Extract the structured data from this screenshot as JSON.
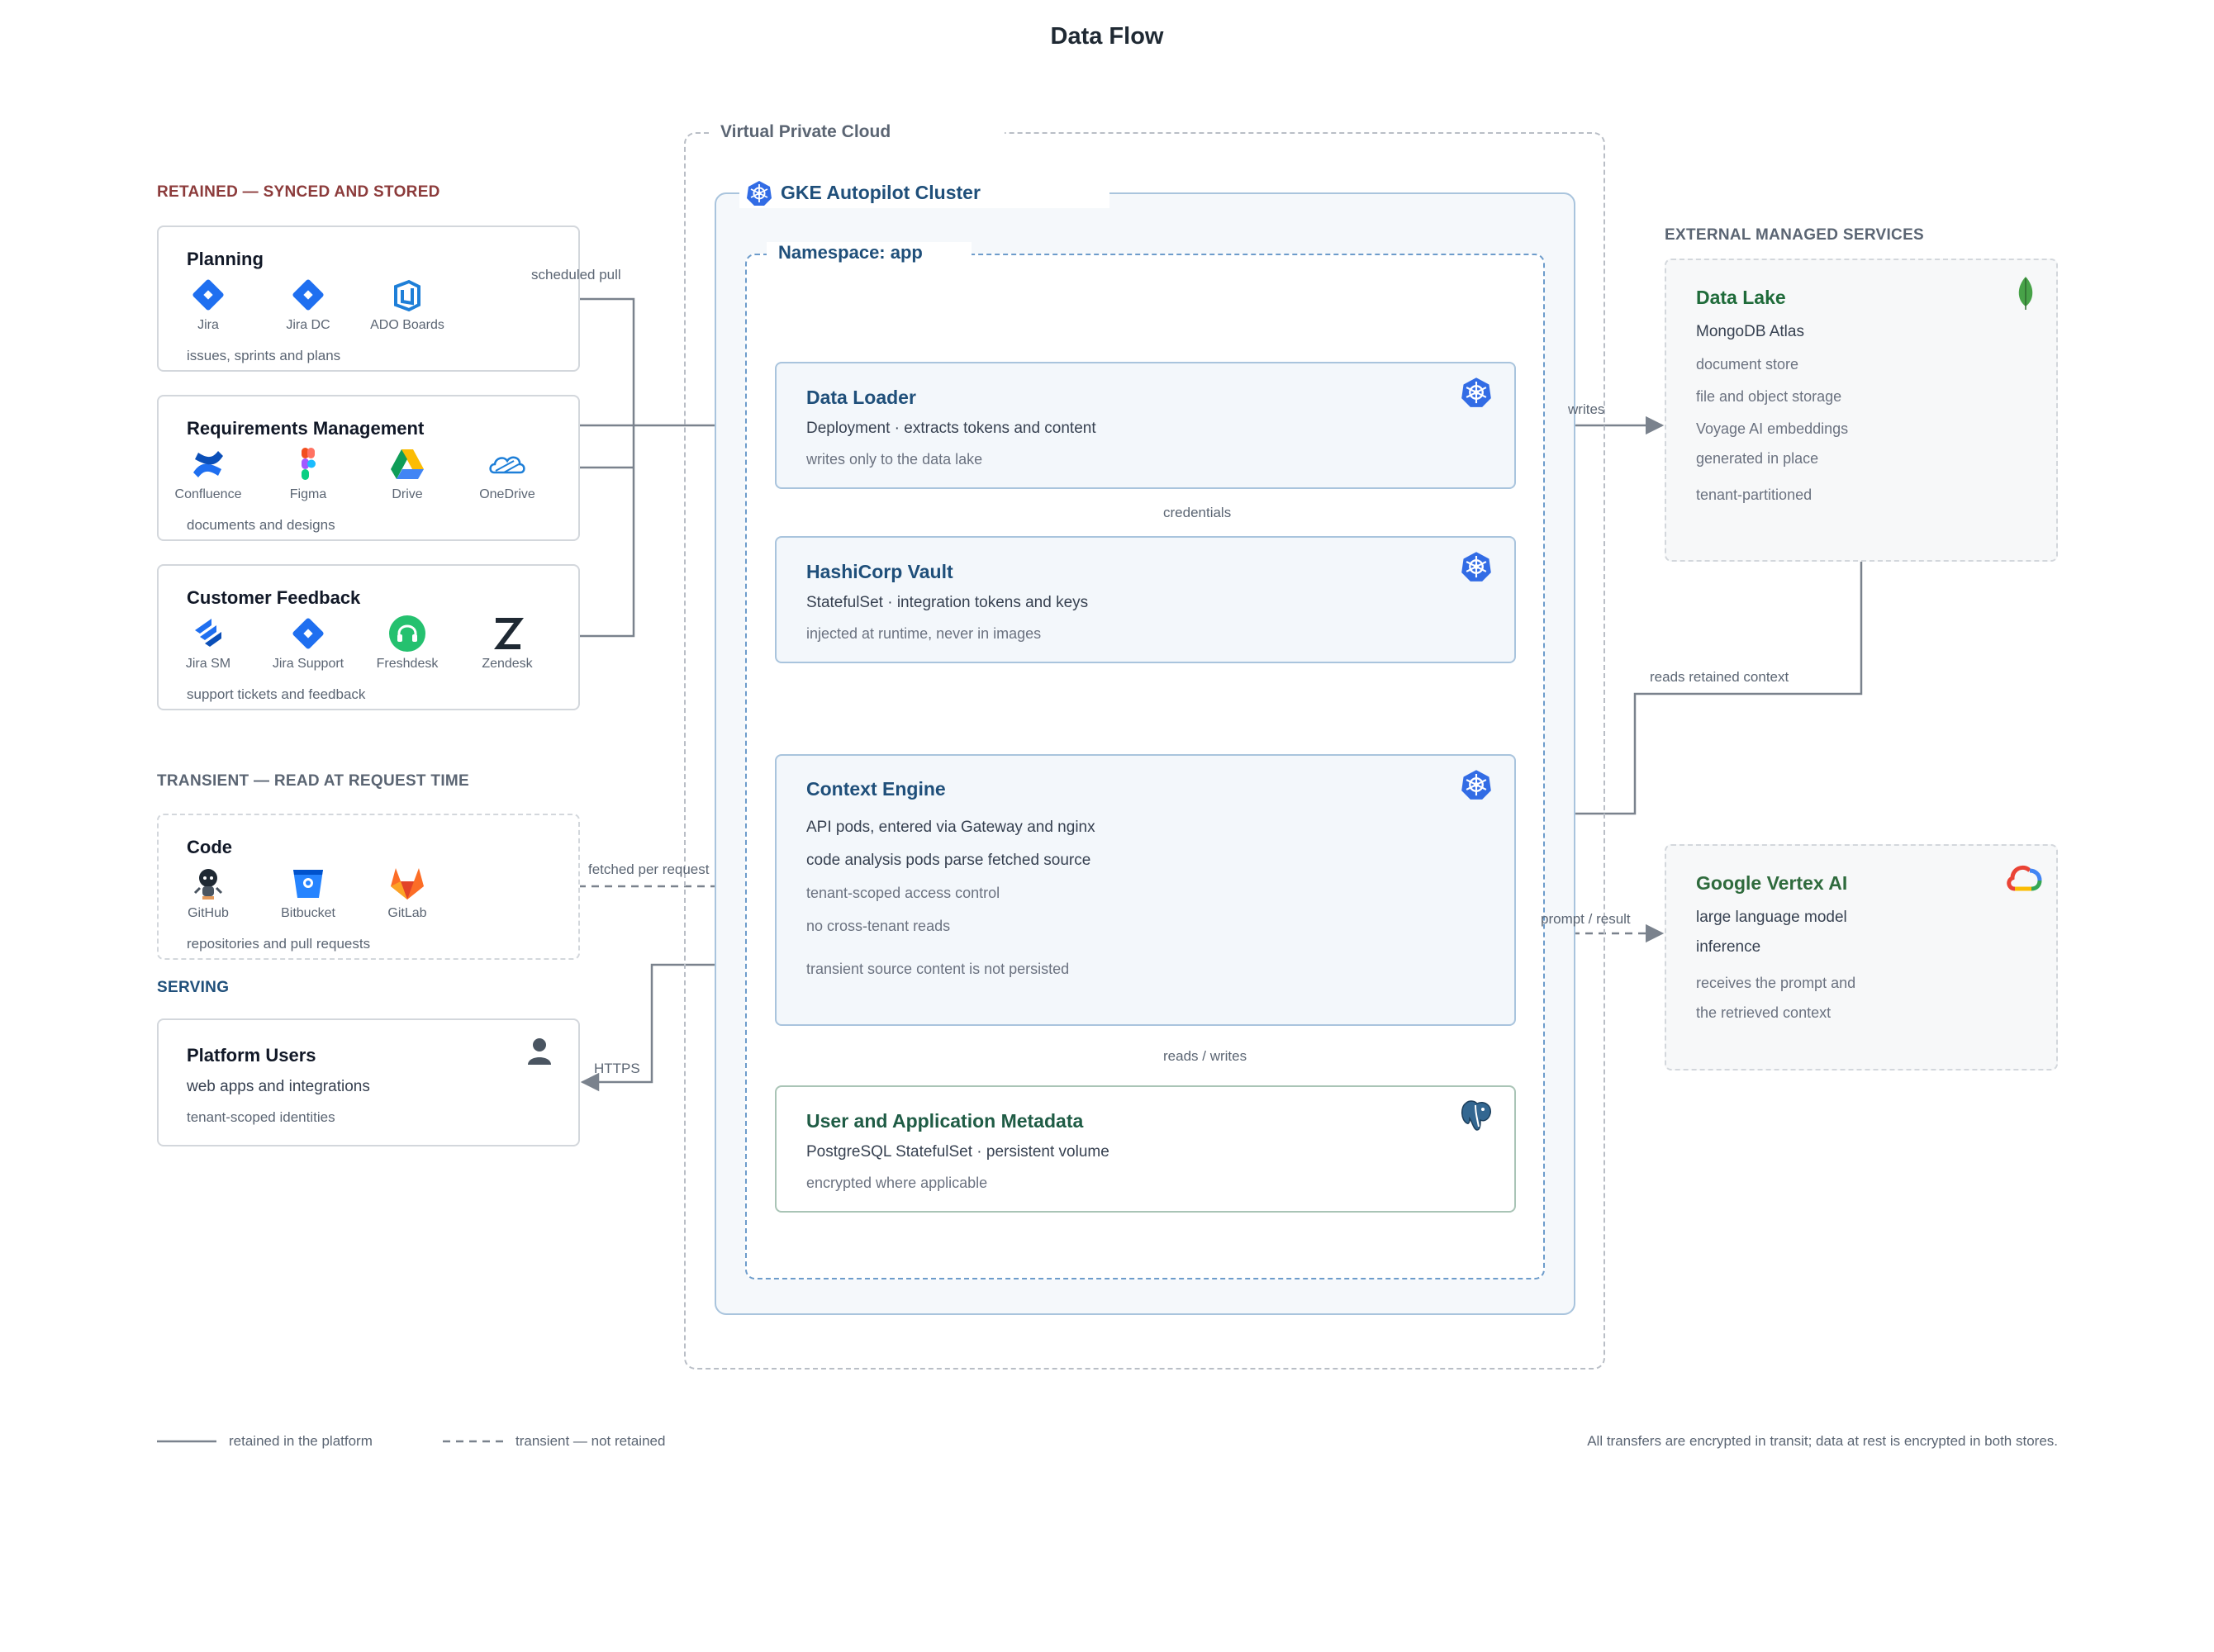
{
  "title": "Data Flow",
  "sections": {
    "retained": "RETAINED — SYNCED AND STORED",
    "transient": "TRANSIENT — READ AT REQUEST TIME",
    "serving": "SERVING",
    "external": "EXTERNAL MANAGED SERVICES"
  },
  "sources": {
    "planning": {
      "title": "Planning",
      "tools": [
        "Jira",
        "Jira DC",
        "ADO Boards"
      ],
      "caption": "issues, sprints and plans"
    },
    "requirements": {
      "title": "Requirements Management",
      "tools": [
        "Confluence",
        "Figma",
        "Drive",
        "OneDrive"
      ],
      "caption": "documents and designs"
    },
    "feedback": {
      "title": "Customer Feedback",
      "tools": [
        "Jira SM",
        "Jira Support",
        "Freshdesk",
        "Zendesk"
      ],
      "caption": "support tickets and feedback"
    },
    "code": {
      "title": "Code",
      "tools": [
        "GitHub",
        "Bitbucket",
        "GitLab"
      ],
      "caption": "repositories and pull requests"
    }
  },
  "users": {
    "title": "Platform Users",
    "line1": "web apps and integrations",
    "line2": "tenant-scoped identities",
    "icon": "user-icon"
  },
  "vpc": {
    "label": "Virtual Private Cloud"
  },
  "cluster": {
    "label": "GKE Autopilot Cluster",
    "icon": "kubernetes-icon"
  },
  "namespace": {
    "label": "Namespace: app"
  },
  "services": {
    "loader": {
      "title": "Data Loader",
      "line1": "Deployment · extracts tokens and content",
      "line2": "writes only to the data lake",
      "icon": "kubernetes-icon"
    },
    "vault": {
      "title": "HashiCorp Vault",
      "line1": "StatefulSet · integration tokens and keys",
      "line2": "injected at runtime, never in images",
      "icon": "kubernetes-icon"
    },
    "engine": {
      "title": "Context Engine",
      "line1": "API pods, entered via Gateway and nginx",
      "line2": "code analysis pods parse fetched source",
      "line3": "tenant-scoped access control",
      "line4": "no cross-tenant reads",
      "line5": "transient source content is not persisted",
      "icon": "kubernetes-icon"
    },
    "metadata": {
      "title": "User and Application Metadata",
      "line1": "PostgreSQL StatefulSet · persistent volume",
      "line2": "encrypted where applicable",
      "icon": "postgresql-icon"
    }
  },
  "external": {
    "datalake": {
      "title": "Data Lake",
      "subtitle": "MongoDB Atlas",
      "lines": [
        "document store",
        "file and object storage",
        "Voyage AI embeddings",
        "generated in place",
        "tenant-partitioned"
      ],
      "icon": "mongodb-leaf-icon"
    },
    "vertex": {
      "title": "Google Vertex AI",
      "line1": "large language model",
      "line2": "inference",
      "line3": "receives the prompt and",
      "line4": "the retrieved context",
      "icon": "google-cloud-icon"
    }
  },
  "edges": {
    "scheduled_pull": "scheduled pull",
    "credentials": "credentials",
    "writes": "writes",
    "reads_retained": "reads retained context",
    "fetched": "fetched per request",
    "prompt": "prompt / result",
    "https": "HTTPS",
    "reads_writes": "reads / writes"
  },
  "legend": {
    "retained": "retained in the platform",
    "transient": "transient — not retained",
    "note": "All transfers are encrypted in transit; data at rest is encrypted in both stores."
  },
  "colors": {
    "kubernetes": "#326ce5",
    "arrow": "#7a828d",
    "service_title": "#1f4f7a",
    "retained_header": "#8c3b3b"
  }
}
